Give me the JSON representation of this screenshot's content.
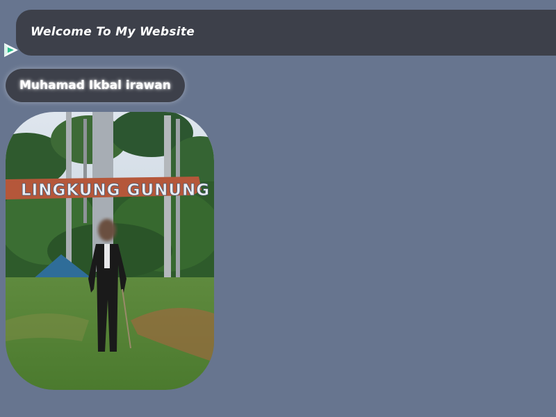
{
  "header": {
    "title": "Welcome To My Website"
  },
  "logo": {
    "icon": "play-triangle-logo-icon",
    "colors": [
      "#ffffff",
      "#2fbf8f"
    ]
  },
  "profile": {
    "name": "Muhamad Ikbal irawan"
  },
  "photo": {
    "sign_text": "LINGKUNG GUNUNG",
    "subject": "person-standing-photo"
  },
  "colors": {
    "background": "#67758f",
    "bar": "#3d404a",
    "text": "#ffffff"
  }
}
